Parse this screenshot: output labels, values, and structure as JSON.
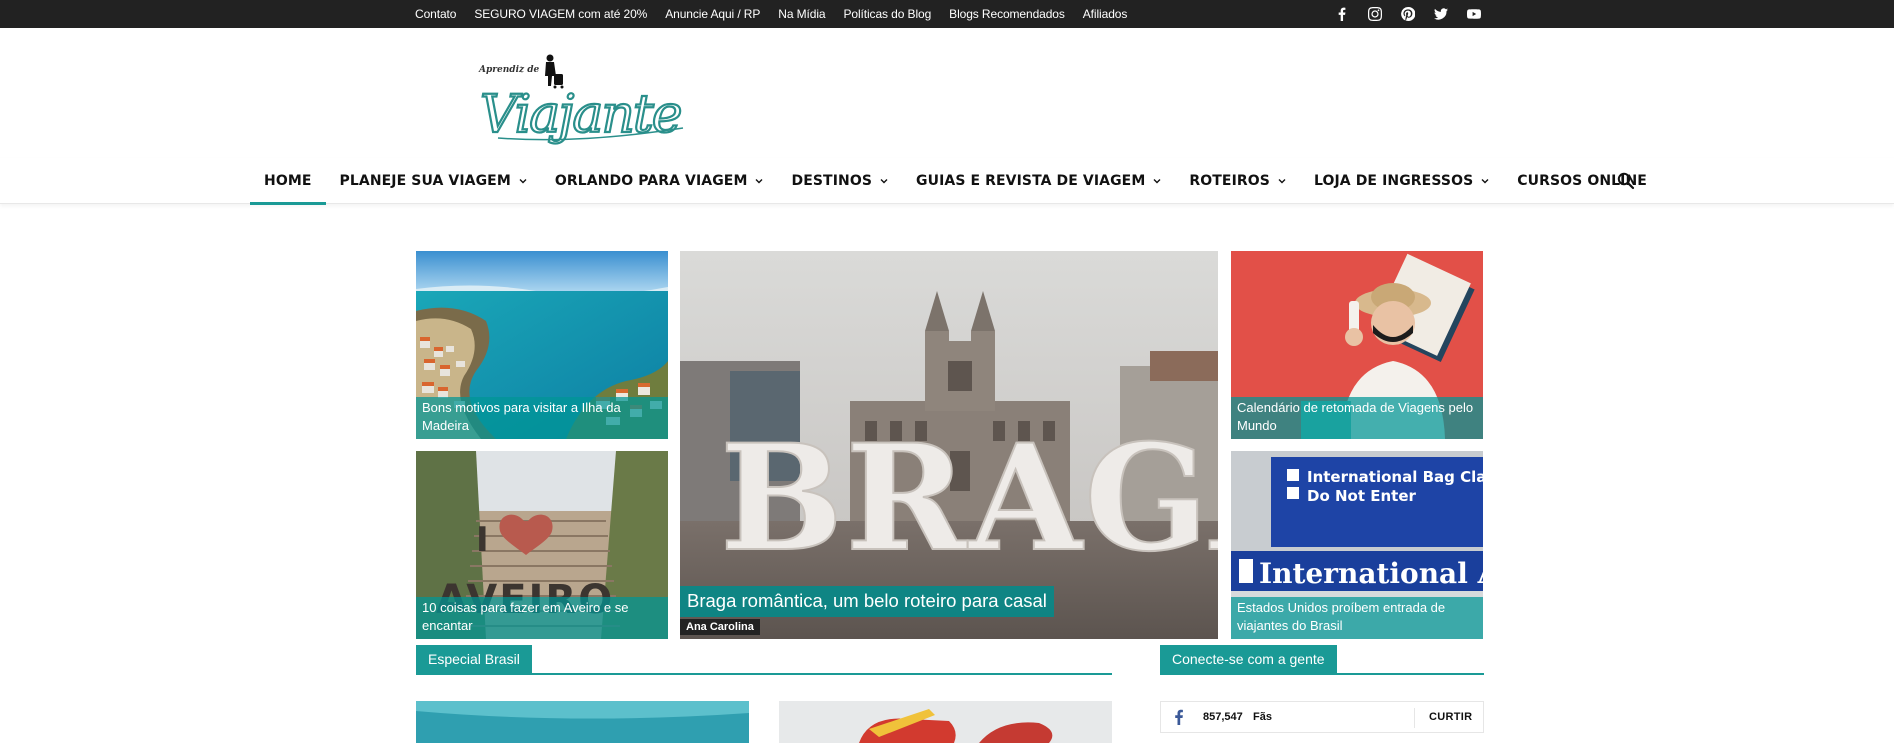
{
  "topbar": {
    "links": [
      "Contato",
      "SEGURO VIAGEM com até 20%",
      "Anuncie Aqui / RP",
      "Na Mídia",
      "Políticas do Blog",
      "Blogs Recomendados",
      "Afiliados"
    ],
    "social_icons": [
      "facebook-icon",
      "instagram-icon",
      "pinterest-icon",
      "twitter-icon",
      "youtube-icon"
    ]
  },
  "logo": {
    "small_text": "Aprendiz de",
    "main_text": "Viajante"
  },
  "nav": {
    "items": [
      {
        "label": "HOME",
        "dropdown": false,
        "active": true
      },
      {
        "label": "PLANEJE SUA VIAGEM",
        "dropdown": true,
        "active": false
      },
      {
        "label": "ORLANDO PARA VIAGEM",
        "dropdown": true,
        "active": false
      },
      {
        "label": "DESTINOS",
        "dropdown": true,
        "active": false
      },
      {
        "label": "GUIAS E REVISTA DE VIAGEM",
        "dropdown": true,
        "active": false
      },
      {
        "label": "ROTEIROS",
        "dropdown": true,
        "active": false
      },
      {
        "label": "LOJA DE INGRESSOS",
        "dropdown": true,
        "active": false
      },
      {
        "label": "CURSOS ONLINE",
        "dropdown": false,
        "active": false
      }
    ]
  },
  "featured": {
    "main": {
      "title": "Braga romântica, um belo roteiro para casal",
      "author": "Ana Carolina",
      "sign_text": "BRAGA"
    },
    "madeira": {
      "title": "Bons motivos para visitar a Ilha da Madeira"
    },
    "aveiro": {
      "title": "10 coisas para fazer em Aveiro e se encantar",
      "sign_text": "AVEIRO"
    },
    "calendario": {
      "title": "Calendário de retomada de Viagens pelo Mundo"
    },
    "eua": {
      "title": "Estados Unidos proíbem entrada de viajantes do Brasil",
      "sign_line1": "International Bag Claim",
      "sign_line2": "Do Not Enter",
      "sign_line3": "International Arrivals"
    }
  },
  "sections": {
    "especial_brasil": "Especial Brasil",
    "conecte": "Conecte-se com a gente"
  },
  "facebook": {
    "count": "857,547",
    "fans_label": "Fãs",
    "like_label": "CURTIR"
  },
  "colors": {
    "accent": "#1a9a96",
    "topbar": "#222222"
  }
}
